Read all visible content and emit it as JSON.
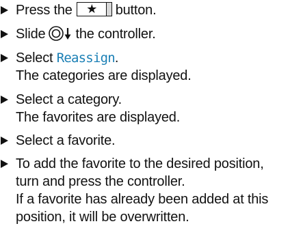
{
  "steps": [
    {
      "before": "Press the",
      "key_symbol": "★",
      "after": "button."
    },
    {
      "before": "Slide",
      "after": "the controller.",
      "icon": "controller-slide-down-icon"
    },
    {
      "before": "Select",
      "term": "Reassign",
      "after": ".",
      "result": "The categories are displayed."
    },
    {
      "text": "Select a category.",
      "result": "The favorites are displayed."
    },
    {
      "text": "Select a favorite."
    },
    {
      "lines": [
        "To add the favorite to the desired position,",
        "turn and press the controller."
      ],
      "result_lines": [
        "If a favorite has already been added at this",
        "position, it will be overwritten."
      ]
    }
  ],
  "colors": {
    "text": "#111111",
    "menu_term": "#1a7fb5",
    "key_shade": "#d8d8d8"
  },
  "icons": {
    "bullet": "triangle-right",
    "controller": "controller-slide-down-icon"
  }
}
